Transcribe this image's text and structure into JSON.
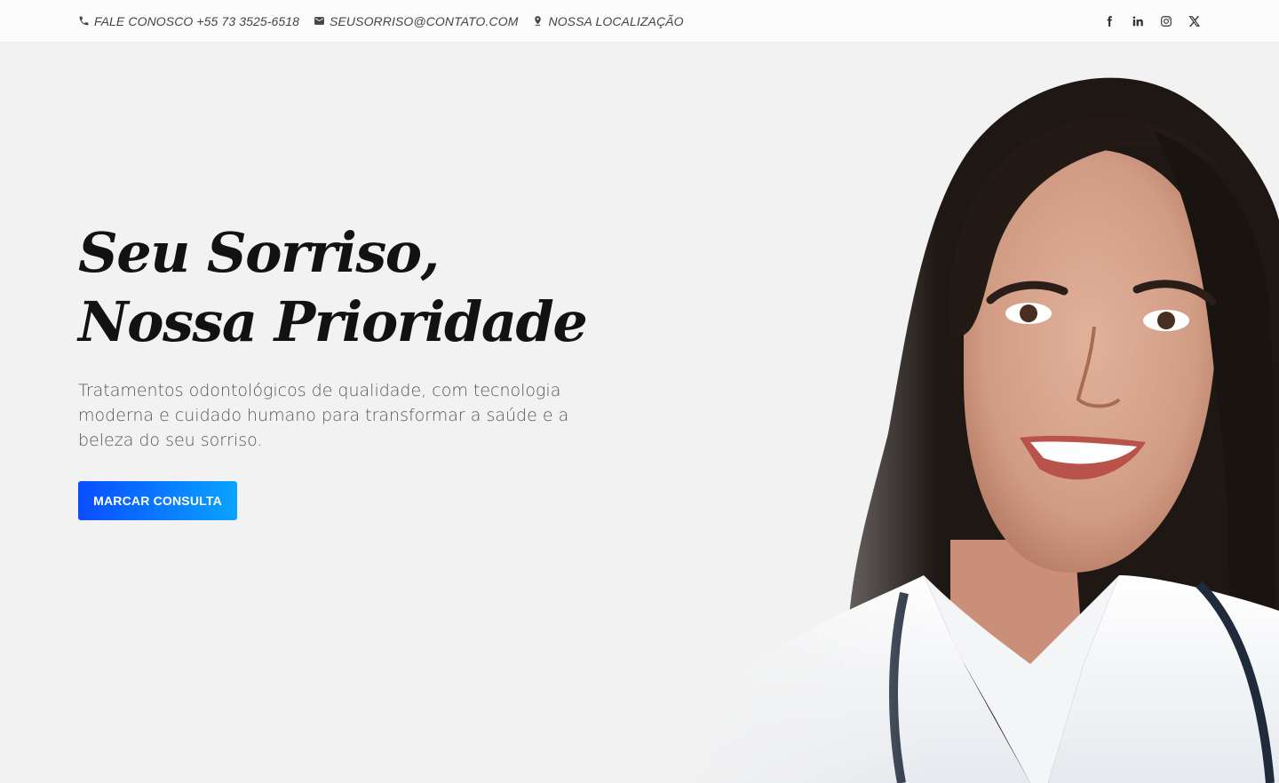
{
  "topbar": {
    "contacts": [
      {
        "icon": "phone-icon",
        "text": "FALE CONOSCO +55 73 3525-6518"
      },
      {
        "icon": "mail-icon",
        "text": "SEUSORRISO@CONTATO.COM"
      },
      {
        "icon": "location-pin-icon",
        "text": "NOSSA LOCALIZAÇÃO"
      }
    ],
    "social": [
      {
        "icon": "facebook-icon",
        "label": "Facebook"
      },
      {
        "icon": "linkedin-icon",
        "label": "LinkedIn"
      },
      {
        "icon": "instagram-icon",
        "label": "Instagram"
      },
      {
        "icon": "x-twitter-icon",
        "label": "X"
      }
    ]
  },
  "hero": {
    "title_line1": "Seu Sorriso,",
    "title_line2": "Nossa Prioridade",
    "subtitle": "Tratamentos odontológicos de qualidade, com tecnologia moderna e cuidado humano para transformar a saúde e a beleza do seu sorriso.",
    "cta_label": "MARCAR CONSULTA",
    "image_alt": "Dentista sorrindo"
  },
  "colors": {
    "accent_start": "#0a4dff",
    "accent_end": "#0aa3ff",
    "background": "#f2f2f2",
    "title": "#121212"
  }
}
